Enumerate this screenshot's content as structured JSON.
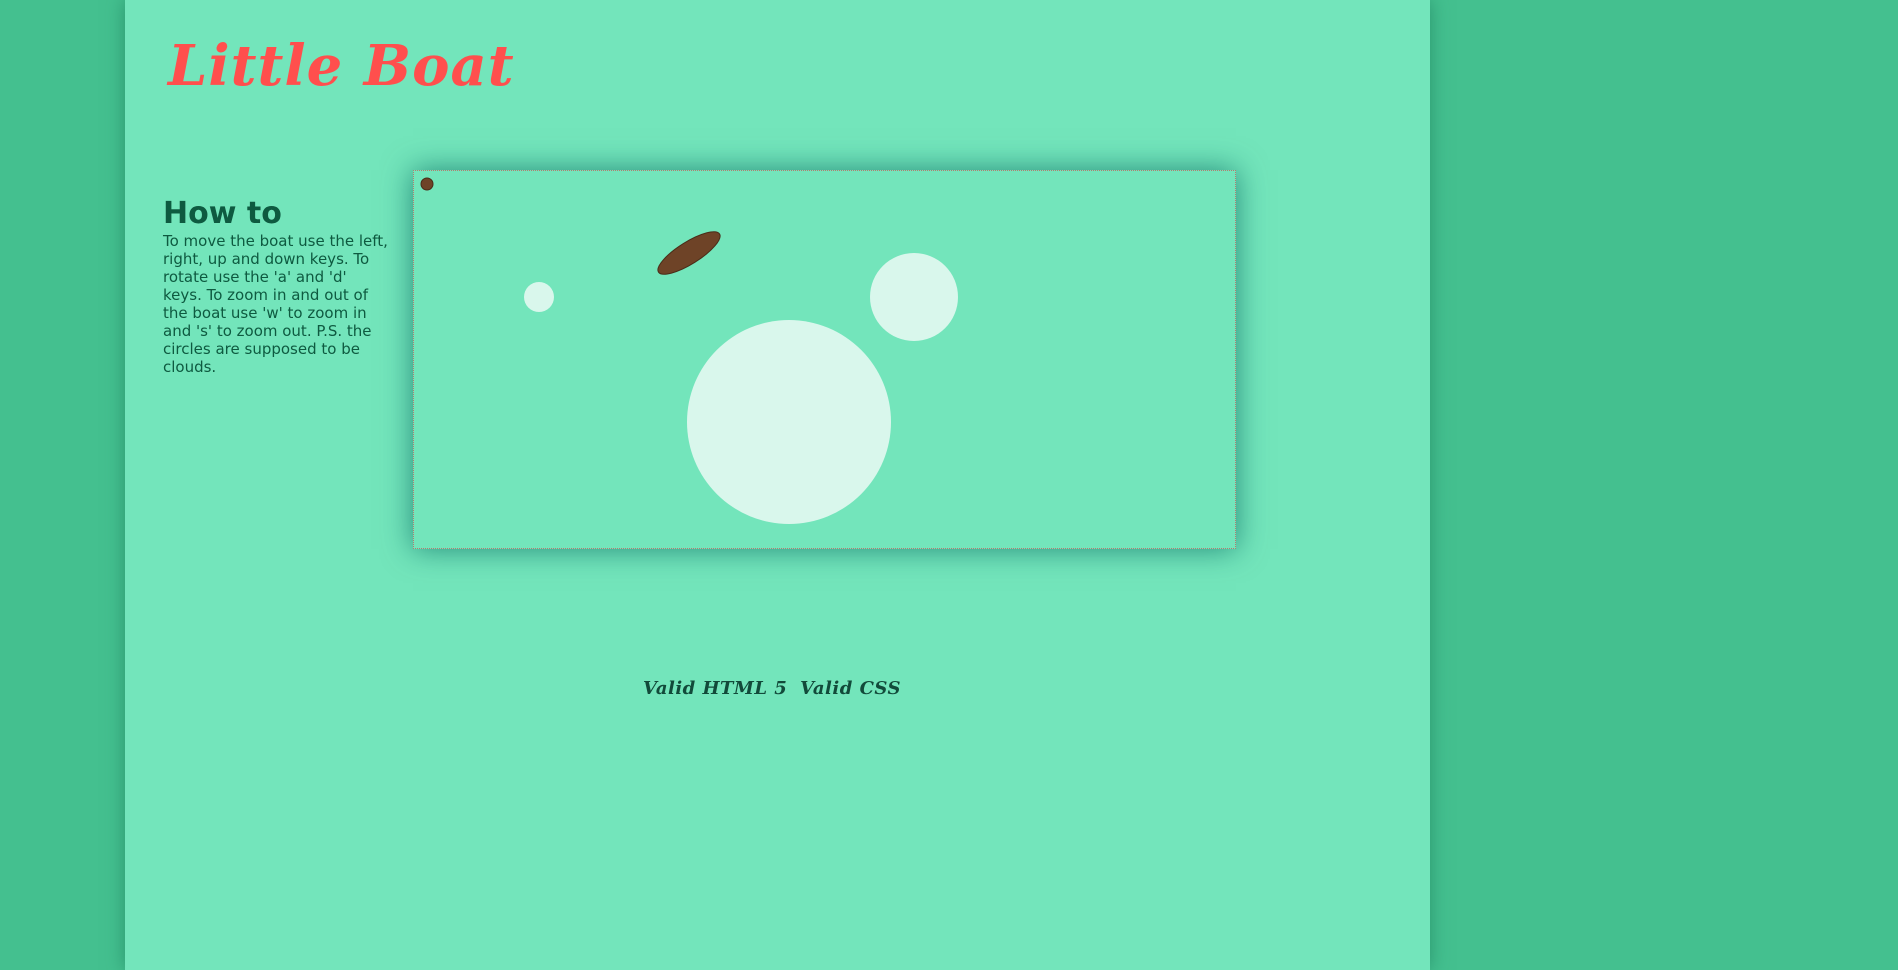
{
  "header": {
    "title": "Little Boat"
  },
  "howto": {
    "heading": "How to",
    "text": "To move the boat use the left, right, up and down keys. To rotate use the 'a' and 'd' keys. To zoom in and out of the boat use 'w' to zoom in and 's' to zoom out. P.S. the circles are supposed to be clouds."
  },
  "game": {
    "boat_color": "#6e4327",
    "cloud_color": "#d9f7ec",
    "sea_color": "#73e5bb",
    "controls": {
      "move": [
        "left",
        "right",
        "up",
        "down"
      ],
      "rotate": [
        "a",
        "d"
      ],
      "zoom_in": "w",
      "zoom_out": "s"
    }
  },
  "footer": {
    "html_link": "Valid HTML 5",
    "css_link": "Valid CSS"
  },
  "colors": {
    "page_bg": "#44c08f",
    "content_bg": "#73e5bb",
    "title": "#ff4f4d",
    "text": "#0e5a40"
  }
}
